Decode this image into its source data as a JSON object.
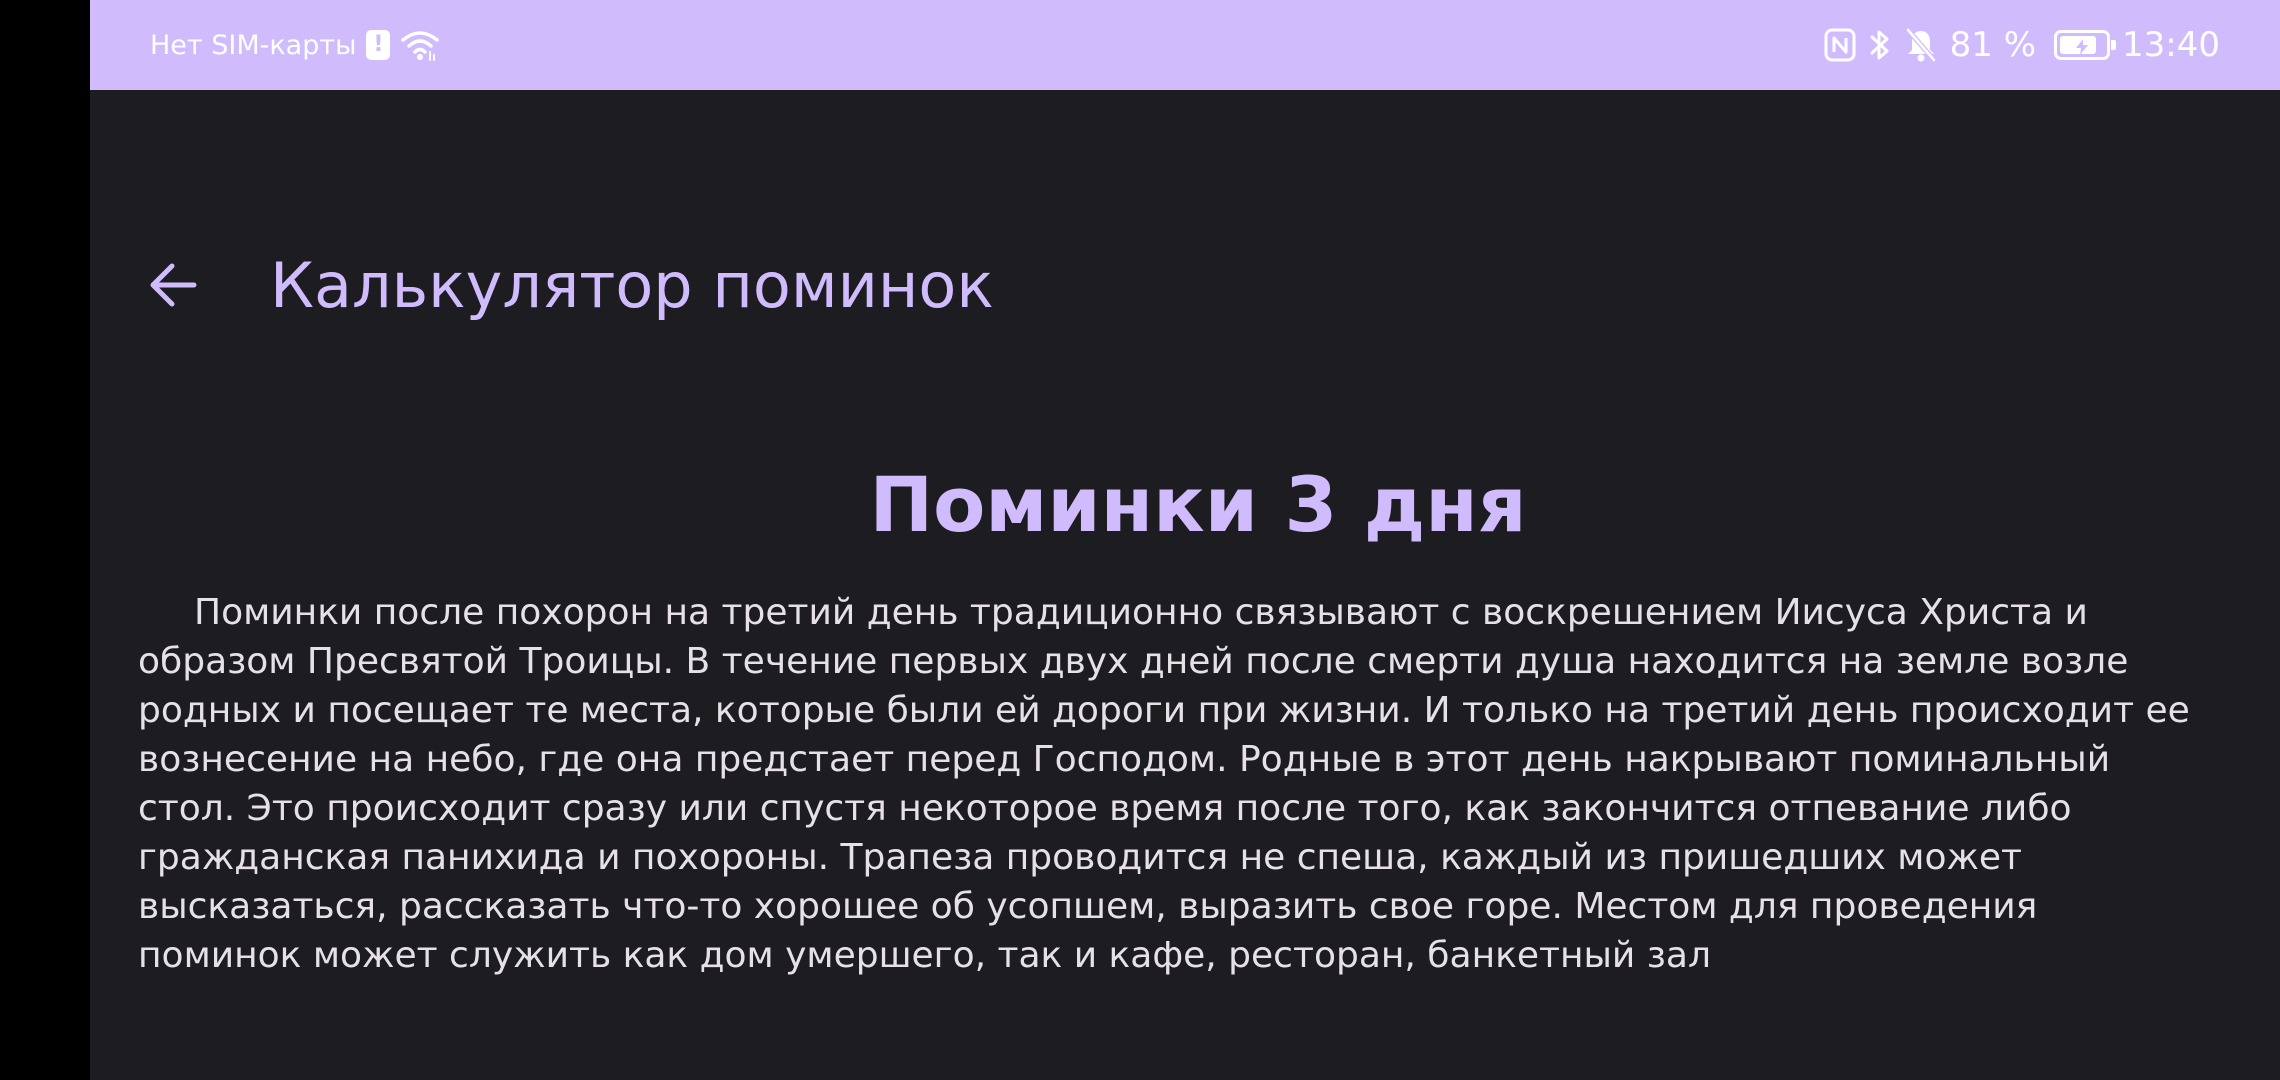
{
  "status_bar": {
    "carrier": "Нет SIM-карты",
    "sim_alert_glyph": "!",
    "battery_percent": "81 %",
    "battery_level": 0.81,
    "time": "13:40",
    "icons": [
      "sim-alert-icon",
      "wifi-icon",
      "nfc-icon",
      "bluetooth-icon",
      "bell-off-icon",
      "battery-charging-icon"
    ]
  },
  "app_bar": {
    "back_icon": "arrow-back-icon",
    "title": "Калькулятор поминок"
  },
  "content": {
    "heading": "Поминки 3 дня",
    "body": "Поминки после похорон на третий день традиционно связывают с воскрешением Иисуса Христа и образом Пресвятой Троицы. В течение первых двух дней после смерти душа находится на земле возле родных и посещает те места, которые были ей дороги при жизни. И только на третий день происходит ее вознесение на небо, где она предстает перед Господом. Родные в этот день накрывают поминальный стол. Это происходит сразу или спустя некоторое время после того, как закончится отпевание либо гражданская панихида и похороны. Трапеза проводится не спеша, каждый из пришедших может высказаться, рассказать что-то хорошее об усопшем, выразить свое горе. Местом для проведения поминок может служить как дом умершего, так и кафе, ресторан, банкетный зал"
  },
  "colors": {
    "accent": "#d0bcfd",
    "background": "#1d1c21",
    "body_text": "#e6e1e6",
    "status_icons": "#ffffff"
  }
}
